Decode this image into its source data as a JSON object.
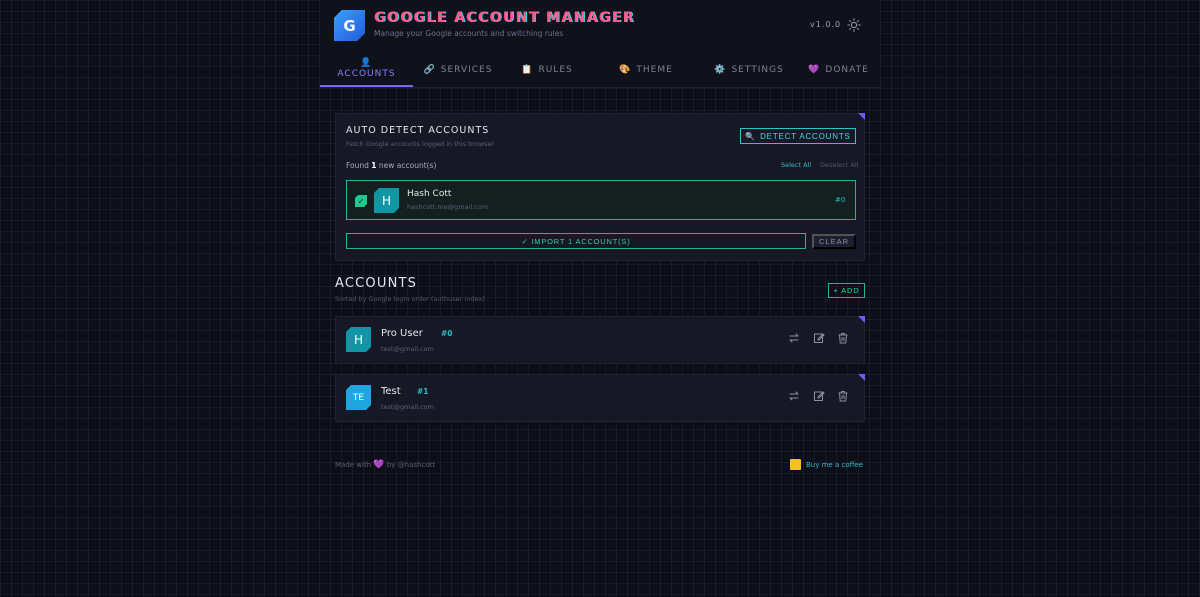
{
  "header": {
    "logo_letter": "G",
    "title": "Google Account Manager",
    "subtitle": "Manage your Google accounts and switching rules",
    "version": "v1.0.0"
  },
  "tabs": [
    {
      "label": "Accounts",
      "icon": "👤",
      "icon_name": "user-icon",
      "active": true
    },
    {
      "label": "Services",
      "icon": "🔗",
      "icon_name": "link-icon",
      "active": false
    },
    {
      "label": "Rules",
      "icon": "📋",
      "icon_name": "clipboard-icon",
      "active": false
    },
    {
      "label": "Theme",
      "icon": "🎨",
      "icon_name": "palette-icon",
      "active": false
    },
    {
      "label": "Settings",
      "icon": "⚙️",
      "icon_name": "gear-icon",
      "active": false
    },
    {
      "label": "Donate",
      "icon": "💜",
      "icon_name": "heart-icon",
      "active": false
    }
  ],
  "detect": {
    "title": "Auto Detect Accounts",
    "subtitle": "Fetch Google accounts logged in this browser",
    "button_label": "Detect Accounts",
    "button_icon": "🔍",
    "found_prefix": "Found",
    "found_count": "1",
    "found_suffix": "new account(s)",
    "select_all": "Select All",
    "deselect_all": "Deselect All",
    "found_account": {
      "initial": "H",
      "name": "Hash Cott",
      "email": "hashcott.me@gmail.com",
      "index": "#0",
      "checked": true
    },
    "import_label": "✓ Import 1 Account(s)",
    "clear_label": "Clear"
  },
  "accounts": {
    "title": "Accounts",
    "subtitle": "Sorted by Google login order (authuser index)",
    "add_label": "+ Add",
    "items": [
      {
        "initial": "H",
        "name": "Pro User",
        "index": "#0",
        "email": "test@gmail.com"
      },
      {
        "initial": "TE",
        "name": "Test",
        "index": "#1",
        "email": "test@gmail.com"
      }
    ]
  },
  "footer": {
    "made_with": "Made with",
    "heart": "💜",
    "by": "by @hashcott",
    "coffee_label": "Buy me a coffee"
  },
  "colors": {
    "accent": "#7a66ff",
    "cyan": "#2fc3c9",
    "green": "#1fb88a",
    "title_pink": "#ff5a8a"
  }
}
